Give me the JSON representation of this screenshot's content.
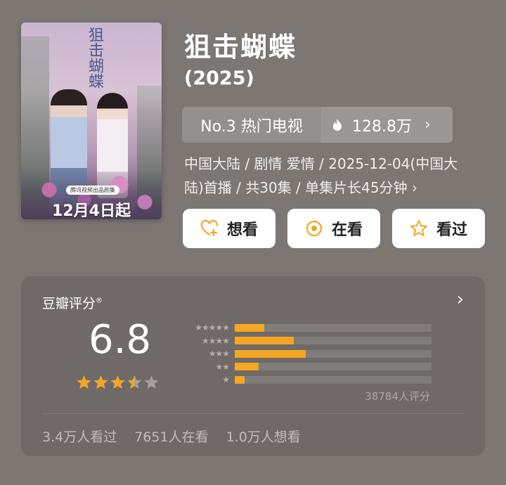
{
  "poster": {
    "title_art": "狙击蝴蝶",
    "badge": "腾讯视频出品剧集",
    "date_text": "12月4日起"
  },
  "show": {
    "title": "狙击蝴蝶",
    "year": "(2025)"
  },
  "rank": {
    "label": "No.3 热门电视",
    "heat": "128.8万",
    "chevron": "›"
  },
  "meta": {
    "line1": "中国大陆 / 剧情 爱情 / 2025-12-04(中国大",
    "line2": "陆)首播 / 共30集 / 单集片长45分钟 ›"
  },
  "actions": [
    {
      "label": "想看",
      "icon": "heart-plus-icon"
    },
    {
      "label": "在看",
      "icon": "target-circle-icon"
    },
    {
      "label": "看过",
      "icon": "star-outline-icon"
    }
  ],
  "rating": {
    "title": "豆瓣评分",
    "registered": "®",
    "score": "6.8",
    "stars_value": 3.5,
    "star_rows": [
      "★★★★★",
      "★★★★",
      "★★★",
      "★★",
      "★"
    ],
    "distribution_percent": [
      15,
      30,
      36,
      12,
      5
    ],
    "count_text": "38784人评分",
    "stats": [
      "3.4万人看过",
      "7651人在看",
      "1.0万人想看"
    ]
  },
  "colors": {
    "background": "#7c7773",
    "accent": "#f5a623",
    "button_bg": "#ffffff"
  }
}
